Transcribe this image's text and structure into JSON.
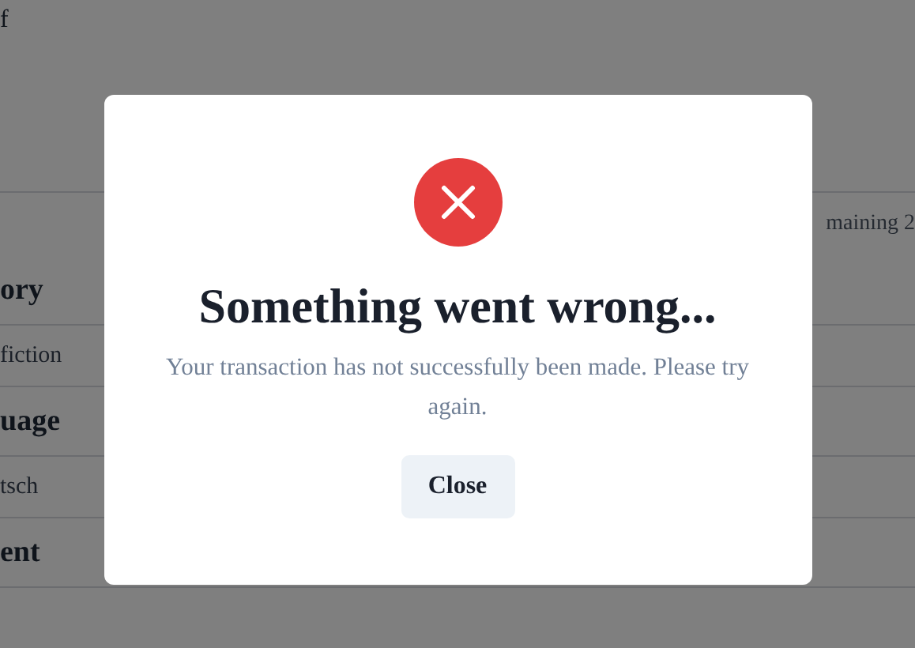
{
  "page": {
    "top_text": "f",
    "remaining_text": "maining 2",
    "sections": [
      {
        "heading": "ory",
        "value": "fiction"
      },
      {
        "heading": "uage",
        "value": "tsch"
      },
      {
        "heading": "ent"
      }
    ]
  },
  "dialog": {
    "kind": "error",
    "title": "Something went wrong...",
    "message": "Your transaction has not successfully been made. Please try again.",
    "button": "Close"
  }
}
